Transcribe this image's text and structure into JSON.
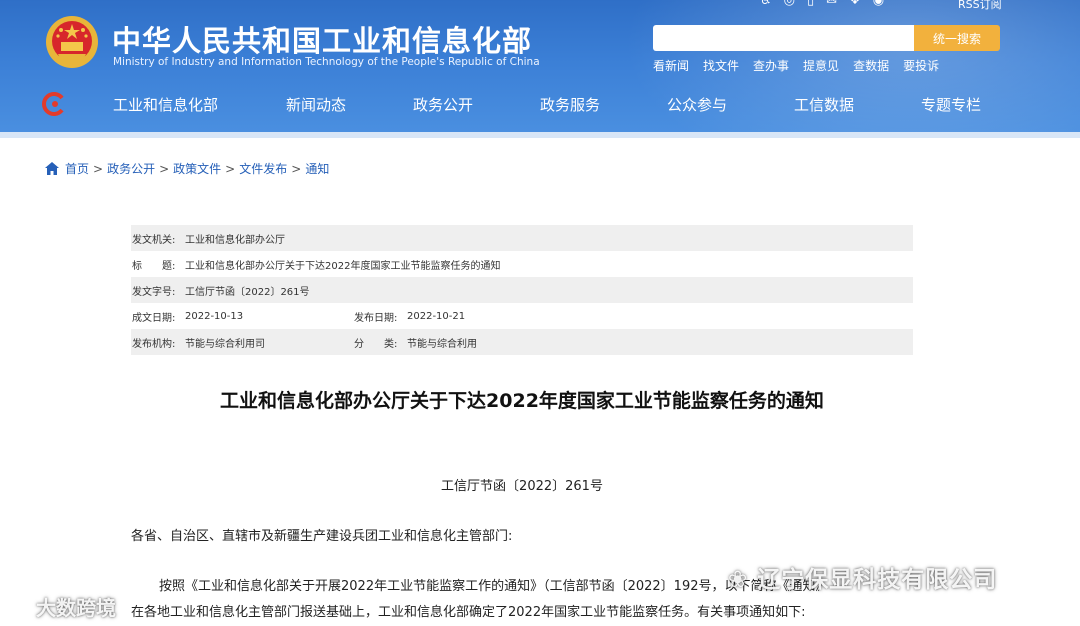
{
  "header": {
    "site_title": "中华人民共和国工业和信息化部",
    "site_subtitle": "Ministry of Industry and Information Technology of the People's Republic of China",
    "rss_label": "RSS订阅",
    "search": {
      "placeholder": "",
      "button_label": "统一搜索"
    },
    "quick_links": [
      "看新闻",
      "找文件",
      "查办事",
      "提意见",
      "查数据",
      "要投诉"
    ],
    "nav": [
      "工业和信息化部",
      "新闻动态",
      "政务公开",
      "政务服务",
      "公众参与",
      "工信数据",
      "专题专栏"
    ],
    "colors": {
      "header_blue": "#3b7fd6",
      "search_button": "#f2b13d"
    }
  },
  "breadcrumb": [
    "首页",
    "政务公开",
    "政策文件",
    "文件发布",
    "通知"
  ],
  "meta": {
    "issuer_label": "发文机关:",
    "issuer": "工业和信息化部办公厅",
    "title_label": "标　　题:",
    "title": "工业和信息化部办公厅关于下达2022年度国家工业节能监察任务的通知",
    "docno_label": "发文字号:",
    "docno": "工信厅节函〔2022〕261号",
    "created_label": "成文日期:",
    "created": "2022-10-13",
    "published_label": "发布日期:",
    "published": "2022-10-21",
    "org_label": "发布机构:",
    "org": "节能与综合利用司",
    "category_label": "分　　类:",
    "category": "节能与综合利用"
  },
  "document": {
    "title": "工业和信息化部办公厅关于下达2022年度国家工业节能监察任务的通知",
    "number": "工信厅节函〔2022〕261号",
    "addressee": "各省、自治区、直辖市及新疆生产建设兵团工业和信息化主管部门:",
    "para1": "按照《工业和信息化部关于开展2022年工业节能监察工作的通知》（工信部节函〔2022〕192号，以下简称《通知》",
    "para2": "在各地工业和信息化主管部门报送基础上，工业和信息化部确定了2022年国家工业节能监察任务。有关事项通知如下:"
  },
  "watermarks": {
    "right": "辽宁保显科技有限公司",
    "left": "大数跨境"
  }
}
